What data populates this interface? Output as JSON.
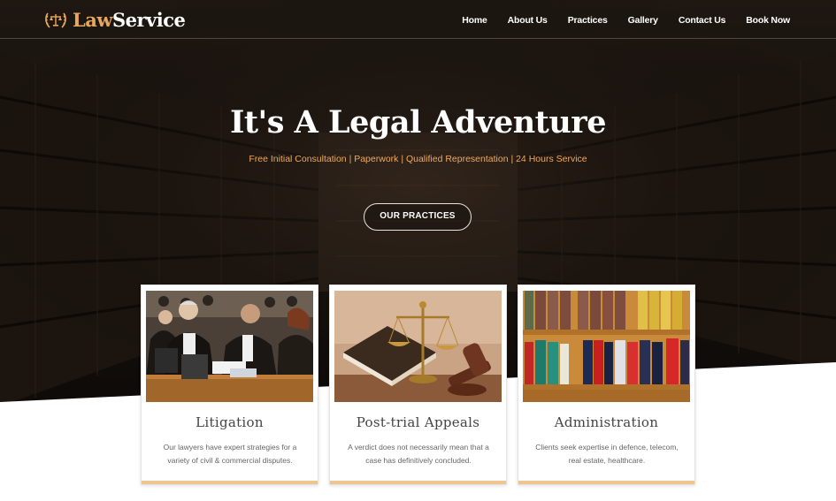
{
  "brand": {
    "law": "Law",
    "service": "Service",
    "icon": "scales-laurel-icon"
  },
  "nav": {
    "items": [
      "Home",
      "About Us",
      "Practices",
      "Gallery",
      "Contact Us",
      "Book Now"
    ]
  },
  "hero": {
    "title": "It's A Legal Adventure",
    "subtitle": "Free Initial Consultation | Paperwork | Qualified Representation | 24 Hours Service",
    "button": "OUR PRACTICES"
  },
  "cards": [
    {
      "title": "Litigation",
      "text": "Our lawyers have expert strategies for a variety of civil & commercial disputes.",
      "image": "courtroom-photo"
    },
    {
      "title": "Post-trial Appeals",
      "text": "A verdict does not necessarily mean that a case has definitively concluded.",
      "image": "scales-gavel-photo"
    },
    {
      "title": "Administration",
      "text": "Clients seek expertise in defence, telecom, real estate, healthcare.",
      "image": "law-books-photo"
    }
  ],
  "colors": {
    "accent": "#e8a85a",
    "card_bar": "#eec48f",
    "hero_bg": "#1e1611"
  }
}
